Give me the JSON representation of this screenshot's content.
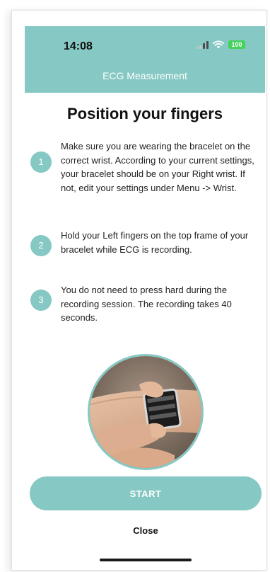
{
  "status_bar": {
    "time": "14:08",
    "battery": "100",
    "icons": [
      "signal-icon",
      "wifi-icon",
      "battery-icon"
    ]
  },
  "header": {
    "title": "ECG Measurement"
  },
  "main": {
    "title": "Position your fingers",
    "steps": [
      {
        "number": "1",
        "text": "Make sure you are wearing the bracelet on the correct wrist. According to your current settings, your bracelet should be on your Right wrist. If not, edit your settings under Menu -> Wrist."
      },
      {
        "number": "2",
        "text": "Hold your Left fingers on the top frame of your bracelet while ECG is recording."
      },
      {
        "number": "3",
        "text": "You do not need to press hard during the recording session. The recording takes 40 seconds."
      }
    ]
  },
  "actions": {
    "start_label": "START",
    "close_label": "Close"
  },
  "colors": {
    "accent": "#86c8c3",
    "battery": "#45d15a",
    "text": "#222222"
  }
}
